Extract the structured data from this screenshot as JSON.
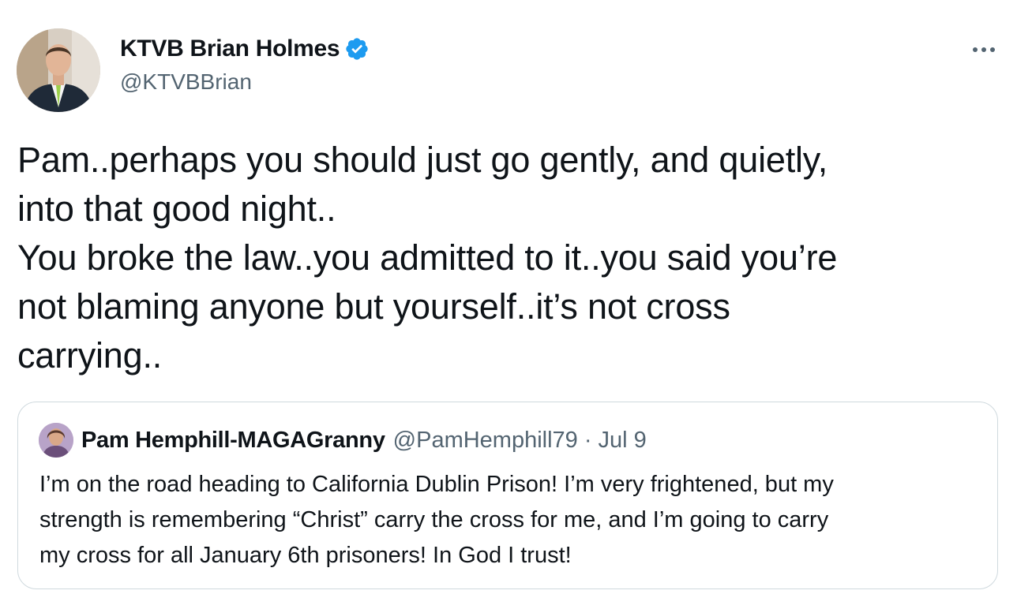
{
  "author": {
    "display_name": "KTVB Brian Holmes",
    "handle": "@KTVBBrian",
    "verified": true,
    "verified_icon": "verified-badge-icon"
  },
  "tweet": {
    "text": "Pam..perhaps you should just go gently, and quietly,\ninto that good night..\nYou broke the law..you admitted to it..you said you’re\nnot blaming anyone but yourself..it’s not cross\ncarrying.."
  },
  "more_icon": "more-dots-icon",
  "quoted": {
    "display_name": "Pam Hemphill-MAGAGranny",
    "handle": "@PamHemphill79",
    "separator": "·",
    "date": "Jul 9",
    "text": "I’m on the road heading to California Dublin Prison! I’m very frightened, but my\nstrength is remembering “Christ” carry the cross for me, and I’m going to carry\nmy cross for all January 6th prisoners! In God I trust!"
  },
  "colors": {
    "text_primary": "#0f1419",
    "text_secondary": "#536471",
    "verified_blue": "#1d9bf0",
    "border": "#cfd9de"
  }
}
